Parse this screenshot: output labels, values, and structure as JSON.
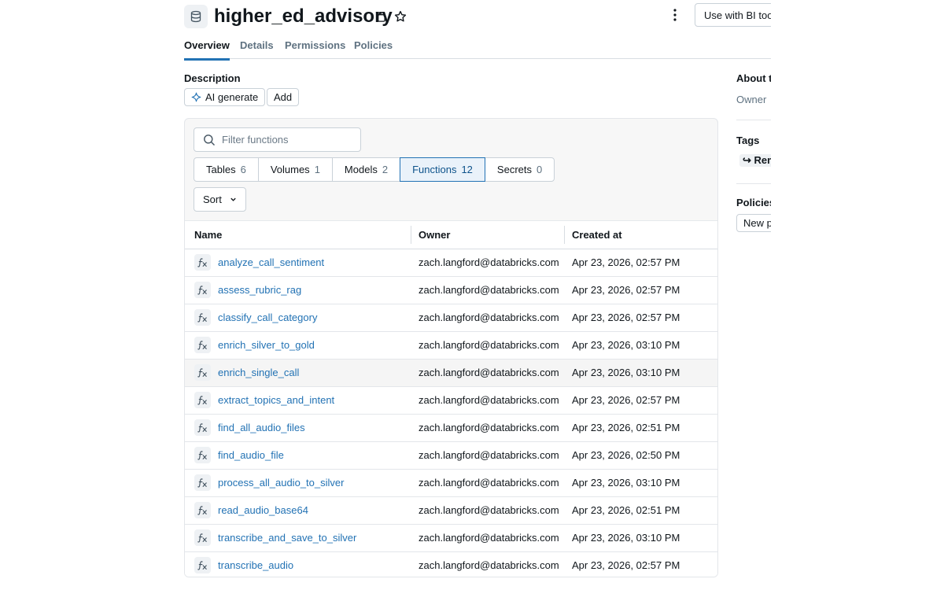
{
  "header": {
    "title": "higher_ed_advisory",
    "bi_button": "Use with BI tools"
  },
  "tabs": [
    {
      "label": "Overview"
    },
    {
      "label": "Details"
    },
    {
      "label": "Permissions"
    },
    {
      "label": "Policies"
    }
  ],
  "description": {
    "label": "Description",
    "ai_generate": "AI generate",
    "add": "Add"
  },
  "filter": {
    "placeholder": "Filter functions"
  },
  "segments": [
    {
      "label": "Tables",
      "count": "6"
    },
    {
      "label": "Volumes",
      "count": "1"
    },
    {
      "label": "Models",
      "count": "2"
    },
    {
      "label": "Functions",
      "count": "12"
    },
    {
      "label": "Secrets",
      "count": "0"
    }
  ],
  "sort_label": "Sort",
  "table": {
    "columns": [
      "Name",
      "Owner",
      "Created at"
    ],
    "rows": [
      {
        "name": "analyze_call_sentiment",
        "owner": "zach.langford@databricks.com",
        "created": "Apr 23, 2026, 02:57 PM"
      },
      {
        "name": "assess_rubric_rag",
        "owner": "zach.langford@databricks.com",
        "created": "Apr 23, 2026, 02:57 PM"
      },
      {
        "name": "classify_call_category",
        "owner": "zach.langford@databricks.com",
        "created": "Apr 23, 2026, 02:57 PM"
      },
      {
        "name": "enrich_silver_to_gold",
        "owner": "zach.langford@databricks.com",
        "created": "Apr 23, 2026, 03:10 PM"
      },
      {
        "name": "enrich_single_call",
        "owner": "zach.langford@databricks.com",
        "created": "Apr 23, 2026, 03:10 PM"
      },
      {
        "name": "extract_topics_and_intent",
        "owner": "zach.langford@databricks.com",
        "created": "Apr 23, 2026, 02:57 PM"
      },
      {
        "name": "find_all_audio_files",
        "owner": "zach.langford@databricks.com",
        "created": "Apr 23, 2026, 02:51 PM"
      },
      {
        "name": "find_audio_file",
        "owner": "zach.langford@databricks.com",
        "created": "Apr 23, 2026, 02:50 PM"
      },
      {
        "name": "process_all_audio_to_silver",
        "owner": "zach.langford@databricks.com",
        "created": "Apr 23, 2026, 03:10 PM"
      },
      {
        "name": "read_audio_base64",
        "owner": "zach.langford@databricks.com",
        "created": "Apr 23, 2026, 02:51 PM"
      },
      {
        "name": "transcribe_and_save_to_silver",
        "owner": "zach.langford@databricks.com",
        "created": "Apr 23, 2026, 03:10 PM"
      },
      {
        "name": "transcribe_audio",
        "owner": "zach.langford@databricks.com",
        "created": "Apr 23, 2026, 02:57 PM"
      }
    ]
  },
  "sidebar": {
    "about_heading": "About this schema",
    "owner_label": "Owner",
    "tags_heading": "Tags",
    "tags_link": "↪ Remove",
    "policies_heading": "Policies",
    "new_policy_button": "New policy"
  }
}
